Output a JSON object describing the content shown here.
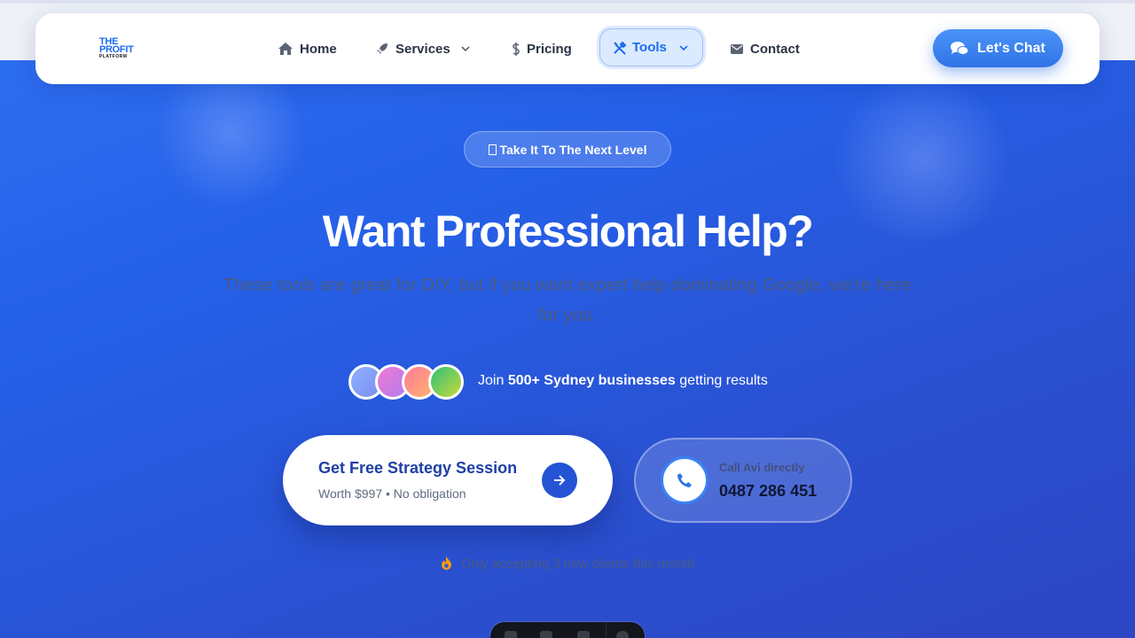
{
  "nav": {
    "logo": {
      "line1": "THE",
      "line2": "PROFIT",
      "line3": "PLATFORM"
    },
    "items": [
      {
        "label": "Home",
        "icon": "home-icon"
      },
      {
        "label": "Services",
        "icon": "rocket-icon",
        "has_dropdown": true
      },
      {
        "label": "Pricing",
        "icon": "dollar-icon"
      },
      {
        "label": "Tools",
        "icon": "tools-icon",
        "has_dropdown": true,
        "active": true
      },
      {
        "label": "Contact",
        "icon": "envelope-icon"
      }
    ],
    "cta_label": "Let's Chat"
  },
  "hero": {
    "badge": "Take It To The Next Level",
    "headline": "Want Professional Help?",
    "subheadline": "These tools are great for DIY, but if you want expert help dominating Google, we're here for you.",
    "social_proof": {
      "prefix": "Join",
      "highlight": "500+ Sydney businesses",
      "suffix": "getting results"
    },
    "primary_cta": {
      "title": "Get Free Strategy Session",
      "subtitle": "Worth $997 • No obligation"
    },
    "call": {
      "label": "Call Avi directly",
      "number": "0487 286 451"
    },
    "scarcity": "Only accepting 3 new clients this month"
  },
  "colors": {
    "brand_blue": "#1d6cf2",
    "hero_bg": "#2560e8",
    "cta_title": "#1f3fa6",
    "scarcity_icon": "#f59e0b"
  }
}
